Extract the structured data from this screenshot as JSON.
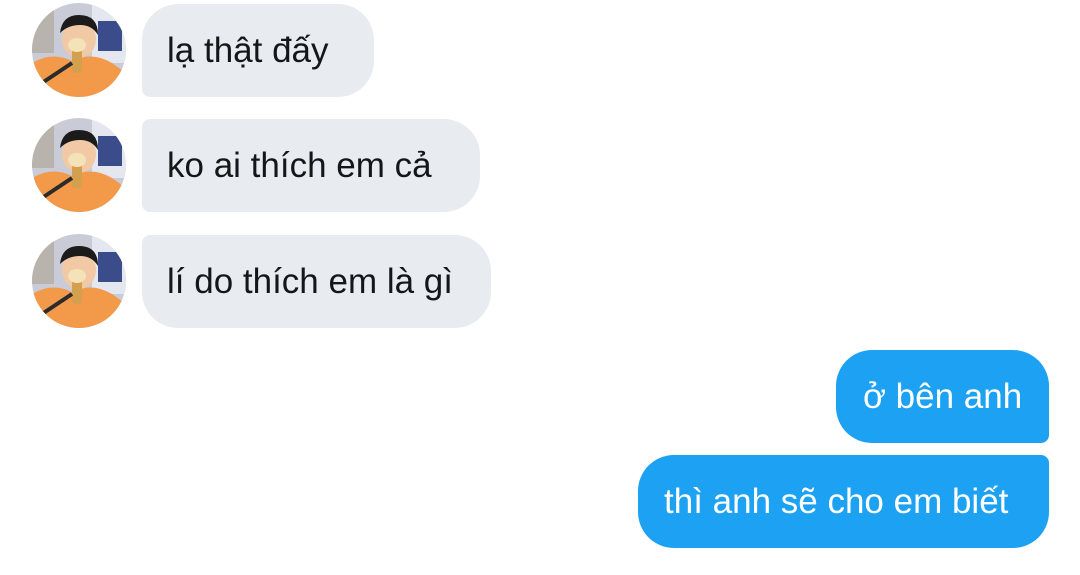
{
  "conversation": {
    "incoming": [
      {
        "text": "lạ thật đấy"
      },
      {
        "text": "ko ai thích em cả"
      },
      {
        "text": "lí do thích em là gì"
      }
    ],
    "outgoing": [
      {
        "text": "ở bên anh"
      },
      {
        "text": "thì anh sẽ cho em biết"
      }
    ]
  },
  "colors": {
    "incoming_bubble": "#e8ecf0",
    "outgoing_bubble": "#1da1f2",
    "background": "#ffffff"
  },
  "icons": {
    "avatar": "user-avatar-icon"
  }
}
